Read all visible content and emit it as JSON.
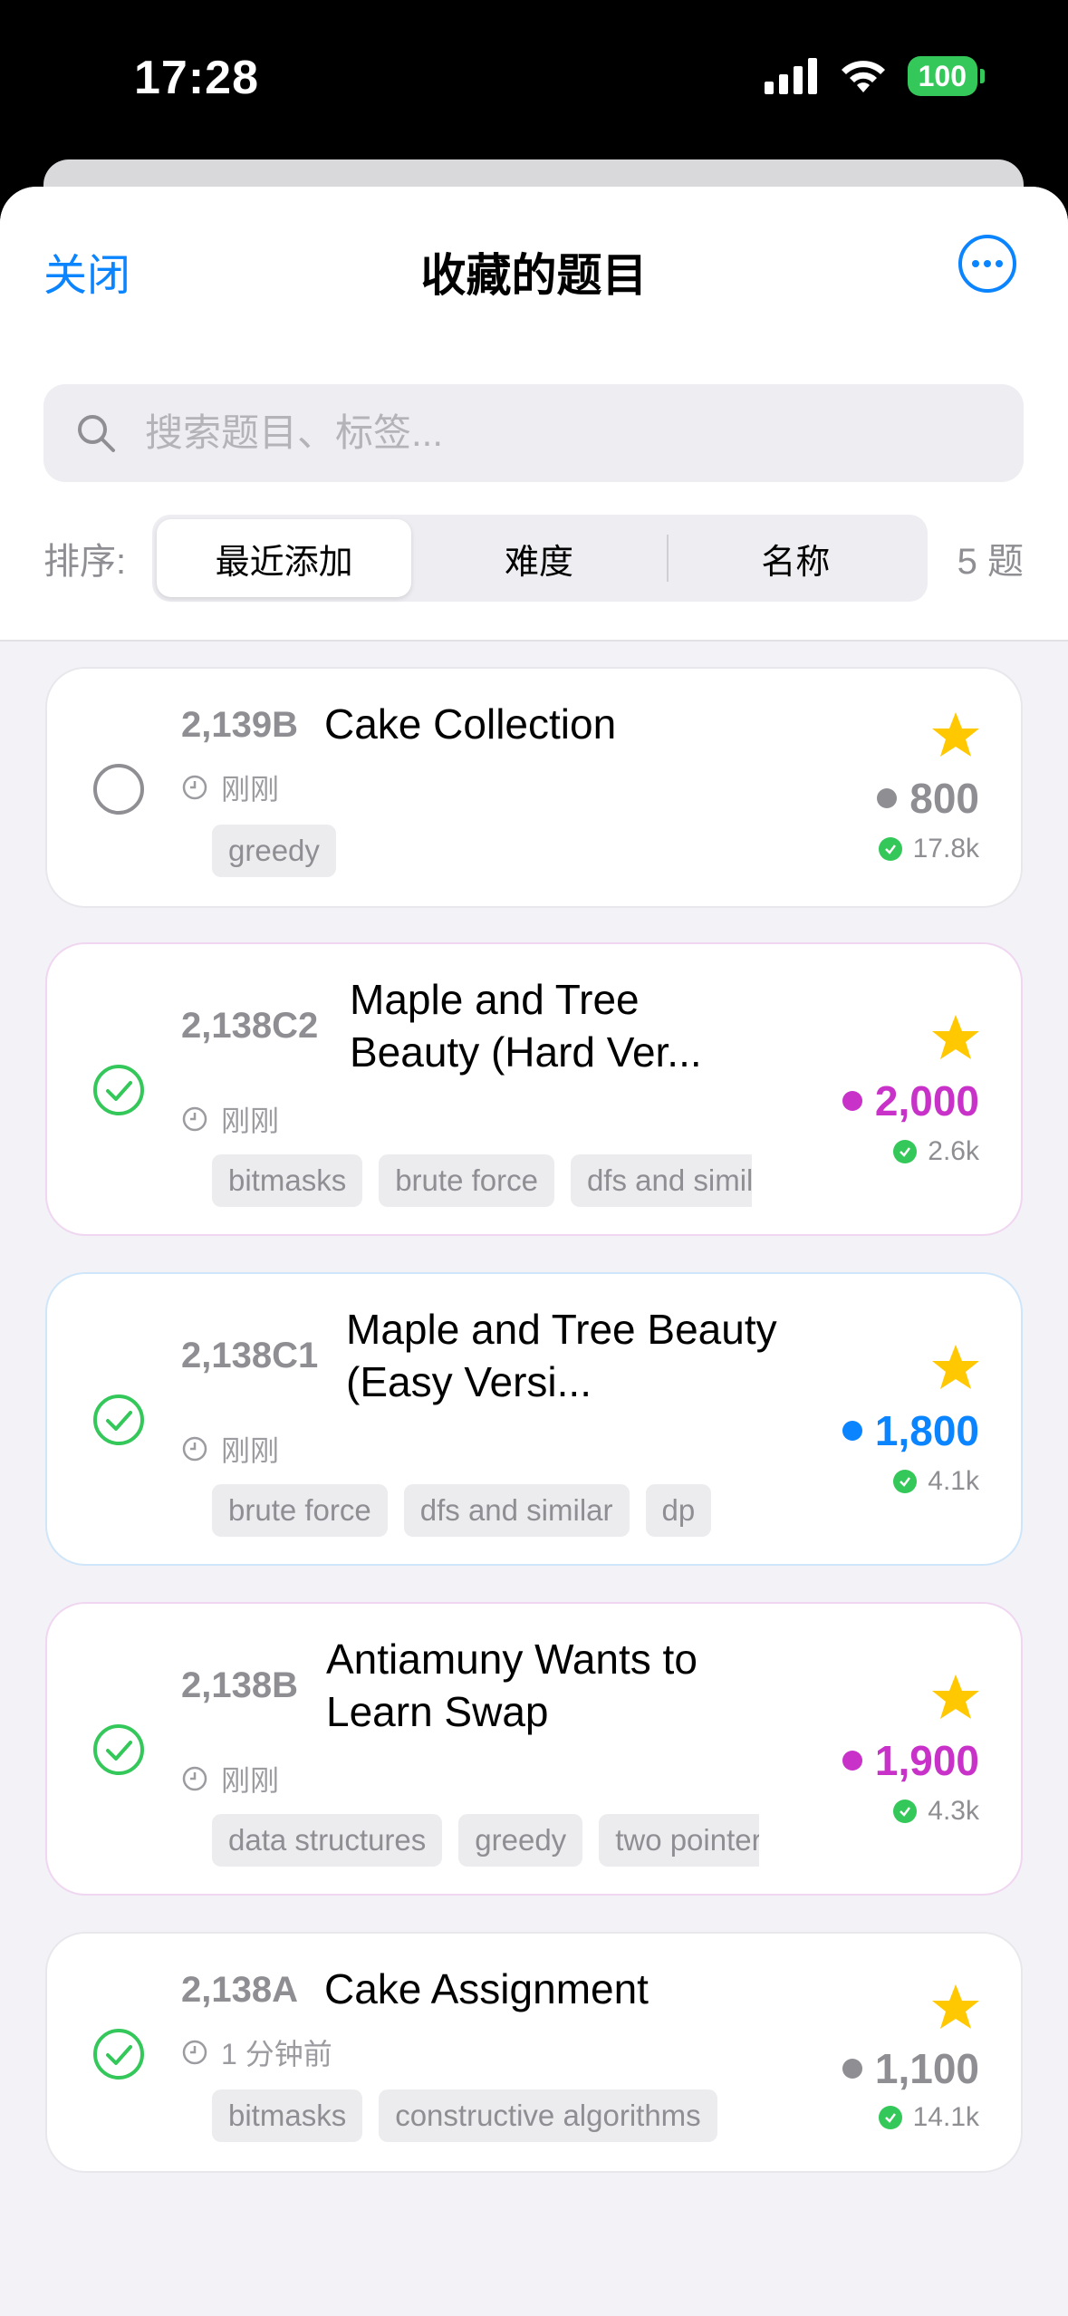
{
  "status_bar": {
    "time": "17:28",
    "battery": "100"
  },
  "header": {
    "close_label": "关闭",
    "title": "收藏的题目"
  },
  "search": {
    "placeholder": "搜索题目、标签..."
  },
  "sort": {
    "label": "排序:",
    "options": [
      "最近添加",
      "难度",
      "名称"
    ],
    "selected": "最近添加",
    "count": "5 题"
  },
  "colors": {
    "accent": "#0a84ff",
    "green": "#34c759",
    "star": "#ffc800",
    "purple": "#c832c8",
    "blue": "#0a84ff",
    "gray": "#8e8e93"
  },
  "problems": [
    {
      "id": "2,139B",
      "name": "Cake Collection",
      "time": "刚刚",
      "tags": [
        "greedy"
      ],
      "rating": "800",
      "rating_color": "#8e8e93",
      "solved_count": "17.8k",
      "solved": false,
      "starred": true
    },
    {
      "id": "2,138C2",
      "name": "Maple and Tree Beauty (Hard Ver...",
      "time": "刚刚",
      "tags": [
        "bitmasks",
        "brute force",
        "dfs and similar"
      ],
      "rating": "2,000",
      "rating_color": "#c832c8",
      "solved_count": "2.6k",
      "solved": true,
      "starred": true
    },
    {
      "id": "2,138C1",
      "name": "Maple and Tree Beauty (Easy Versi...",
      "time": "刚刚",
      "tags": [
        "brute force",
        "dfs and similar",
        "dp"
      ],
      "rating": "1,800",
      "rating_color": "#0a84ff",
      "solved_count": "4.1k",
      "solved": true,
      "starred": true
    },
    {
      "id": "2,138B",
      "name": "Antiamuny Wants to Learn Swap",
      "time": "刚刚",
      "tags": [
        "data structures",
        "greedy",
        "two pointers"
      ],
      "rating": "1,900",
      "rating_color": "#c832c8",
      "solved_count": "4.3k",
      "solved": true,
      "starred": true
    },
    {
      "id": "2,138A",
      "name": "Cake Assignment",
      "time": "1 分钟前",
      "tags": [
        "bitmasks",
        "constructive algorithms"
      ],
      "rating": "1,100",
      "rating_color": "#8e8e93",
      "solved_count": "14.1k",
      "solved": true,
      "starred": true
    }
  ]
}
